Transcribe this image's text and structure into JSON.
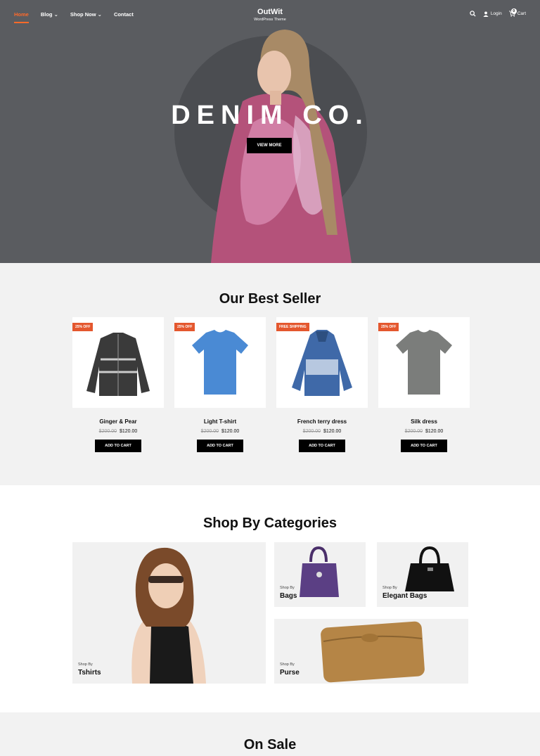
{
  "nav": {
    "items": [
      "Home",
      "Blog",
      "Shop Now",
      "Contact"
    ]
  },
  "brand": {
    "title": "OutWit",
    "subtitle": "WordPress Theme"
  },
  "header_right": {
    "login": "Login",
    "cart": "Cart",
    "cart_count": "0"
  },
  "hero": {
    "title": "DENIM CO.",
    "button": "VIEW MORE"
  },
  "best": {
    "title": "Our Best Seller",
    "products": [
      {
        "name": "Ginger & Pear",
        "badge": "25% OFF",
        "old": "$200.00",
        "price": "$120.00",
        "button": "ADD TO CART"
      },
      {
        "name": "Light T-shirt",
        "badge": "25% OFF",
        "old": "$200.00",
        "price": "$120.00",
        "button": "ADD TO CART"
      },
      {
        "name": "French terry dress",
        "badge": "FREE SHIPPING",
        "old": "$200.00",
        "price": "$120.00",
        "button": "ADD TO CART"
      },
      {
        "name": "Silk dress",
        "badge": "25% OFF",
        "old": "$200.00",
        "price": "$120.00",
        "button": "ADD TO CART"
      }
    ]
  },
  "categories": {
    "title": "Shop By Categories",
    "items": [
      {
        "shop_by": "Shop By",
        "name": "Tshirts"
      },
      {
        "shop_by": "Shop By",
        "name": "Bags"
      },
      {
        "shop_by": "Shop By",
        "name": "Elegant Bags"
      },
      {
        "shop_by": "Shop By",
        "name": "Purse"
      }
    ]
  },
  "sale": {
    "title": "On Sale"
  },
  "colors": {
    "accent": "#ff6a2a",
    "hero_bg": "#5a5c60",
    "badge": "#e4572e"
  }
}
